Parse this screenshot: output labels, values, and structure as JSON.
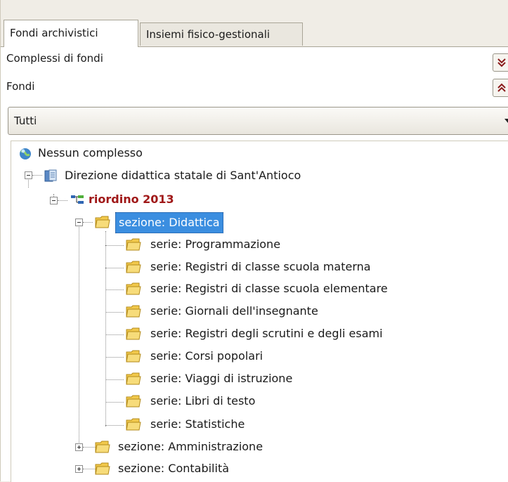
{
  "tabs": [
    {
      "label": "Fondi archivistici",
      "active": true
    },
    {
      "label": "Insiemi fisico-gestionali",
      "active": false
    }
  ],
  "rows": {
    "complessi_label": "Complessi di fondi",
    "fondi_label": "Fondi"
  },
  "filter": {
    "selected": "Tutti"
  },
  "tree": {
    "root": "Nessun complesso",
    "fondo": "Direzione didattica statale di Sant'Antioco",
    "riordino": "riordino 2013",
    "sezione_didattica": "sezione: Didattica",
    "series": [
      "serie: Programmazione",
      "serie: Registri di classe scuola materna",
      "serie: Registri di classe scuola elementare",
      "serie: Giornali dell'insegnante",
      "serie: Registri degli scrutini e degli esami",
      "serie: Corsi popolari",
      "serie: Viaggi di istruzione",
      "serie: Libri di testo",
      "serie: Statistiche"
    ],
    "sezione_amministrazione": "sezione: Amministrazione",
    "sezione_contabilita": "sezione: Contabilità"
  },
  "icons": [
    "globe-icon",
    "archive-icon",
    "hierarchy-icon",
    "folder-icon",
    "expand-all-icon",
    "collapse-all-icon",
    "dropdown-arrow-icon"
  ],
  "colors": {
    "selection": "#3b8ee0",
    "riordino_text": "#a01818",
    "folder": "#f2c94c"
  }
}
